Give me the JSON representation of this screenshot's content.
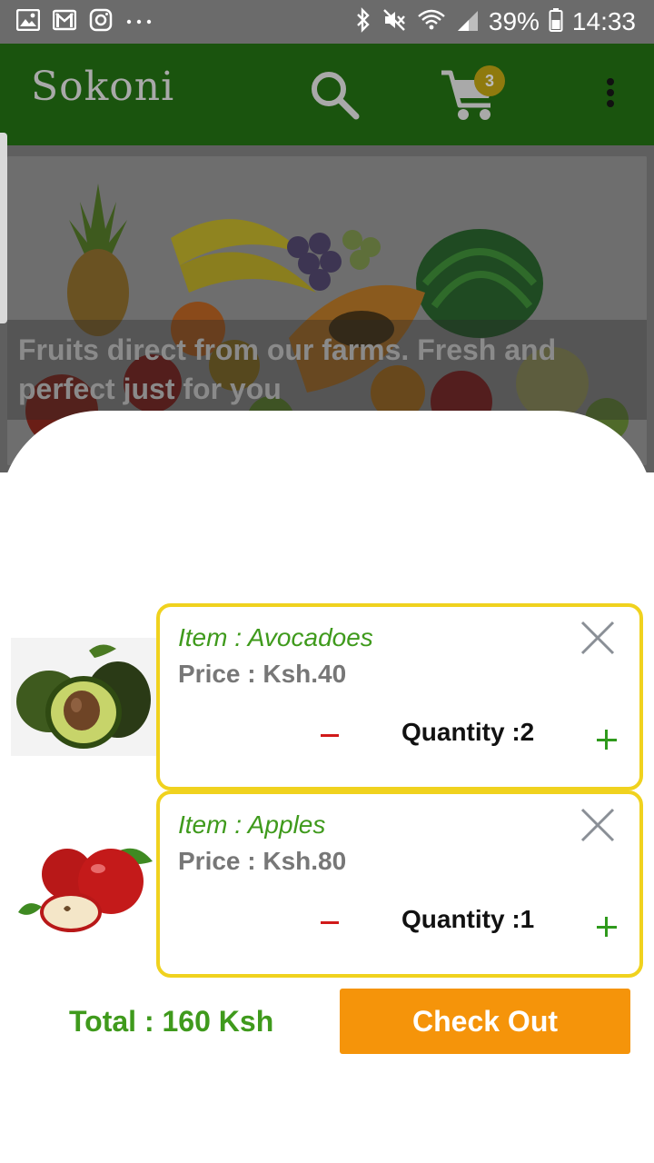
{
  "status_bar": {
    "battery": "39%",
    "time": "14:33",
    "left_icons": [
      "image-icon",
      "gmail-icon",
      "instagram-icon",
      "more-icon"
    ],
    "right_icons": [
      "bluetooth-icon",
      "mute-icon",
      "wifi-icon",
      "signal-icon",
      "battery-icon"
    ]
  },
  "app_bar": {
    "title": "Sokoni",
    "cart_count": "3",
    "colors": {
      "bar": "#1a540e"
    }
  },
  "banner": {
    "caption": "Fruits direct from our farms. Fresh and perfect just for you"
  },
  "cart": {
    "items": [
      {
        "item_label": "Item  : Avocadoes",
        "price_label": "Price : Ksh.40",
        "quantity_label": "Quantity :2",
        "image": "avocado-image"
      },
      {
        "item_label": "Item  : Apples",
        "price_label": "Price : Ksh.80",
        "quantity_label": "Quantity :1",
        "image": "apple-image"
      }
    ],
    "total_label": "Total : 160 Ksh",
    "checkout_label": "Check Out",
    "colors": {
      "card_border": "#f0d21e",
      "accent_green": "#3f9a1c",
      "checkout": "#f5940a",
      "minus": "#d11a1a"
    }
  }
}
